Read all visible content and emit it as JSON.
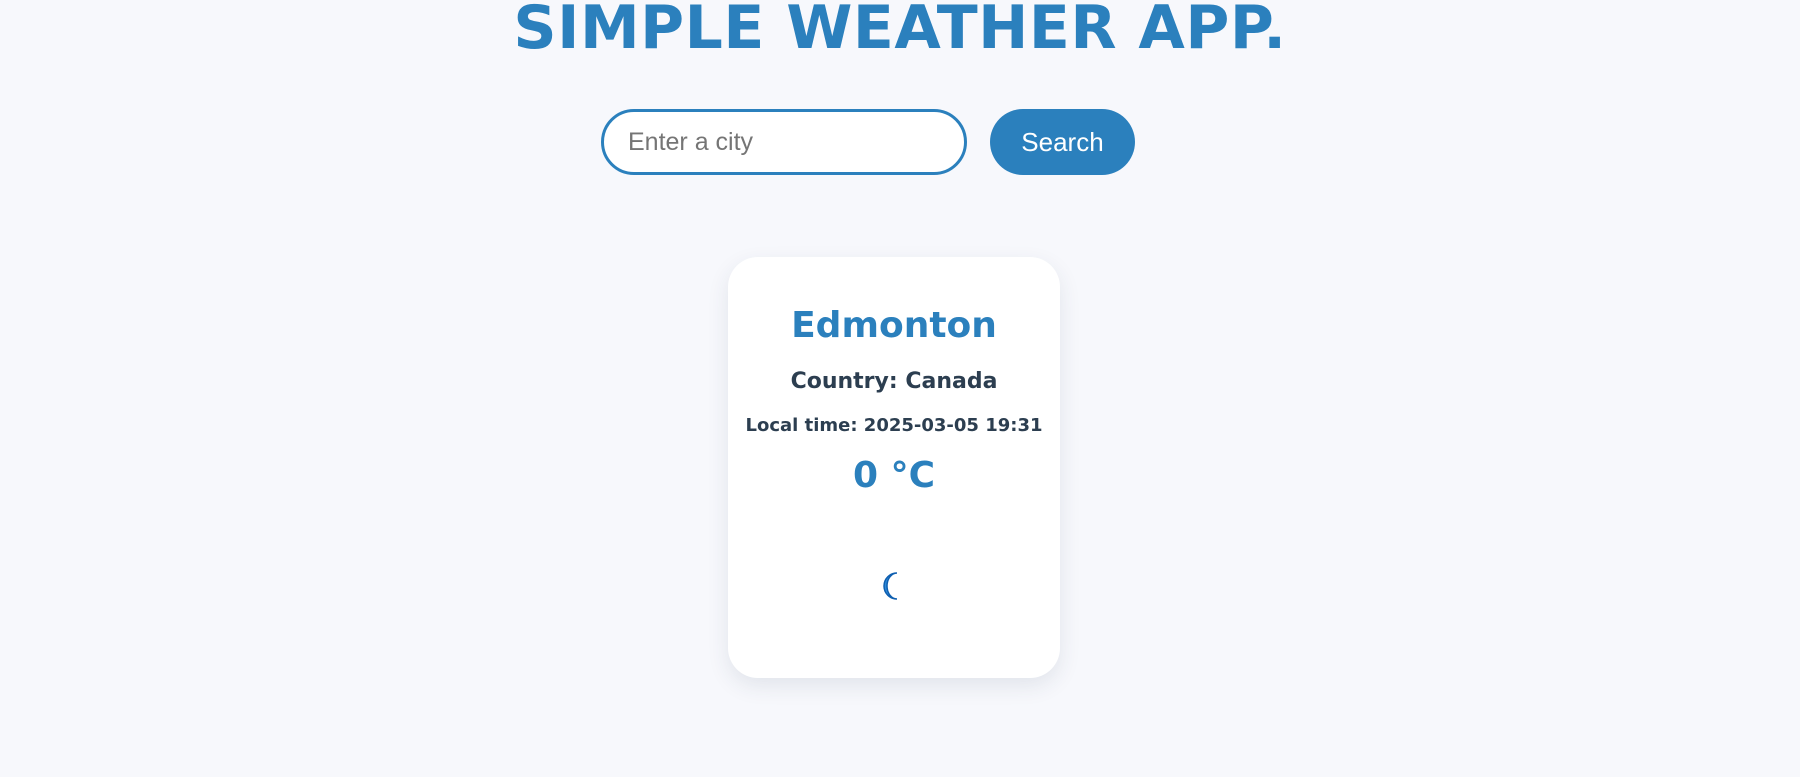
{
  "app": {
    "title": "SIMPLE WEATHER APP."
  },
  "search": {
    "placeholder": "Enter a city",
    "value": "",
    "button_label": "Search"
  },
  "weather": {
    "city": "Edmonton",
    "country_text": "Country: Canada",
    "local_time_text": "Local time: 2025-03-05 19:31",
    "temperature_text": "0 °C",
    "condition_icon": "crescent-moon-icon"
  },
  "colors": {
    "accent": "#2b80bd",
    "text_dark": "#2c3e50",
    "background": "#f7f8fc",
    "card": "#ffffff"
  }
}
